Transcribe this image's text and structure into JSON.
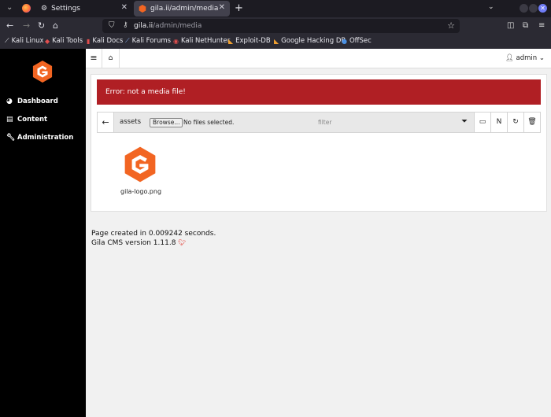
{
  "browser": {
    "tabs": [
      {
        "label": "Settings",
        "icon": "gear-icon",
        "active": false
      },
      {
        "label": "gila.ii/admin/media",
        "icon": "gila-favicon",
        "active": true
      }
    ],
    "url_host": "gila.ii",
    "url_path": "/admin/media",
    "bookmarks": [
      {
        "label": "Kali Linux",
        "icon": "kali-icon"
      },
      {
        "label": "Kali Tools",
        "icon": "kali-tools-icon"
      },
      {
        "label": "Kali Docs",
        "icon": "kali-docs-icon"
      },
      {
        "label": "Kali Forums",
        "icon": "kali-forums-icon"
      },
      {
        "label": "Kali NetHunter",
        "icon": "nethunter-icon"
      },
      {
        "label": "Exploit-DB",
        "icon": "exploit-db-icon"
      },
      {
        "label": "Google Hacking DB",
        "icon": "ghdb-icon"
      },
      {
        "label": "OffSec",
        "icon": "offsec-icon"
      }
    ]
  },
  "sidebar": {
    "items": [
      {
        "label": "Dashboard",
        "icon": "dashboard-icon"
      },
      {
        "label": "Content",
        "icon": "content-icon"
      },
      {
        "label": "Administration",
        "icon": "wrench-icon"
      }
    ]
  },
  "topbar": {
    "user_label": "admin"
  },
  "media": {
    "error_message": "Error: not a media file!",
    "path": "assets",
    "browse_label": "Browse...",
    "no_file_text": "No files selected.",
    "filter_placeholder": "filter",
    "new_button_label": "N",
    "files": [
      {
        "name": "gila-logo.png"
      }
    ]
  },
  "footer": {
    "page_created": "Page created in 0.009242 seconds.",
    "version": "Gila CMS version 1.11.8"
  },
  "colors": {
    "brand_orange": "#f26522",
    "error_red": "#b01f24",
    "sidebar_bg": "#000000"
  }
}
